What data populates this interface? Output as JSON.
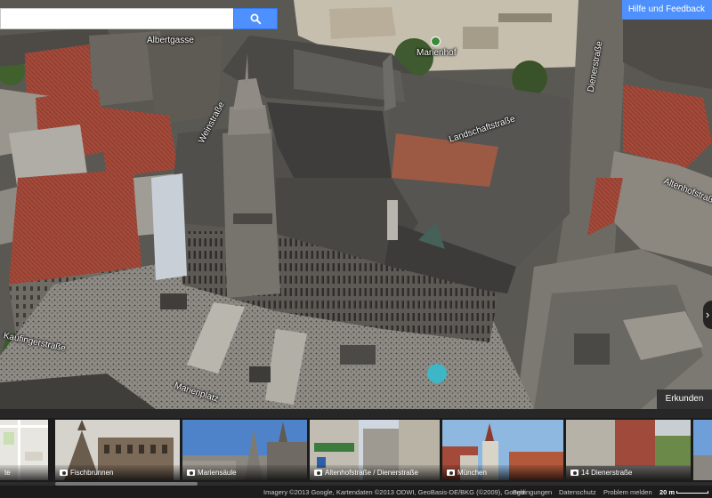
{
  "search": {
    "value": "",
    "placeholder": ""
  },
  "header": {
    "feedback_label": "Hilfe und Feedback"
  },
  "map": {
    "streets": [
      {
        "label": "Albertgasse"
      },
      {
        "label": "Marienhof"
      },
      {
        "label": "Weinstraße"
      },
      {
        "label": "Landschaftstraße"
      },
      {
        "label": "Kaufingerstraße"
      },
      {
        "label": "Marienplatz"
      },
      {
        "label": "Dienerstraße"
      },
      {
        "label": "Altenhofstraße"
      }
    ],
    "explore_label": "Erkunden",
    "next_arrow": "›"
  },
  "filmstrip": {
    "items": [
      {
        "caption": "te"
      },
      {
        "caption": "Fischbrunnen"
      },
      {
        "caption": "Mariensäule"
      },
      {
        "caption": "Altenhofstraße / Dienerstraße"
      },
      {
        "caption": "München"
      },
      {
        "caption": "14 Dienerstraße"
      }
    ]
  },
  "footer": {
    "imagery": "Imagery ©2013 Google, Kartendaten ©2013 ODWI, GeoBasis-DE/BKG (©2009), Google",
    "terms": "Bedingungen",
    "privacy": "Datenschutz",
    "report": "Problem melden",
    "scale": "20 m"
  },
  "colors": {
    "accent": "#4d90fe",
    "strip_bg": "#1c1c1c"
  }
}
